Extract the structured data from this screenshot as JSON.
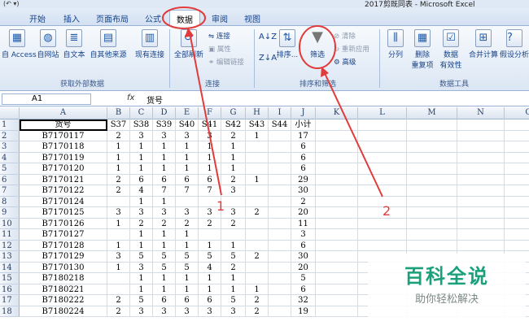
{
  "window": {
    "qat": "(↶ ▾)",
    "title": "2017剪既同表 - Microsoft Excel"
  },
  "tabs": [
    "开始",
    "插入",
    "页面布局",
    "公式",
    "数据",
    "审阅",
    "视图"
  ],
  "active_tab": "数据",
  "ribbon": {
    "get_external": {
      "from_access": "自 Access",
      "from_web": "自网站",
      "from_text": "自文本",
      "from_other": "自其他来源",
      "existing": "现有连接",
      "label": "获取外部数据"
    },
    "connections": {
      "refresh_all": "全部刷新",
      "connections": "连接",
      "properties": "属性",
      "edit_links": "编辑链接",
      "label": "连接"
    },
    "sort_filter": {
      "sort": "排序...",
      "filter": "筛选",
      "clear": "清除",
      "reapply": "重新应用",
      "advanced": "高级",
      "label": "排序和筛选"
    },
    "data_tools": {
      "text_to_cols": "分列",
      "remove_dup_1": "删除",
      "remove_dup_2": "重复项",
      "validation_1": "数据",
      "validation_2": "有效性",
      "consolidate": "合并计算",
      "whatif": "假设分析",
      "label": "数据工具"
    }
  },
  "formula_bar": {
    "name_box": "A1",
    "fx": "fx",
    "value": "货号"
  },
  "columns": [
    "A",
    "B",
    "C",
    "D",
    "E",
    "F",
    "G",
    "H",
    "I",
    "J",
    "K",
    "L",
    "M",
    "N",
    "O"
  ],
  "rows": [
    {
      "n": "1",
      "cells": [
        "货号",
        "S37",
        "S38",
        "S39",
        "S40",
        "S41",
        "S42",
        "S43",
        "S44",
        "小计"
      ]
    },
    {
      "n": "2",
      "cells": [
        "B7170117",
        "2",
        "3",
        "3",
        "3",
        "3",
        "2",
        "1",
        "",
        "17"
      ]
    },
    {
      "n": "3",
      "cells": [
        "B7170118",
        "1",
        "1",
        "1",
        "1",
        "1",
        "1",
        "",
        "",
        "6"
      ]
    },
    {
      "n": "4",
      "cells": [
        "B7170119",
        "1",
        "1",
        "1",
        "1",
        "1",
        "1",
        "",
        "",
        "6"
      ]
    },
    {
      "n": "5",
      "cells": [
        "B7170120",
        "1",
        "1",
        "1",
        "1",
        "1",
        "1",
        "",
        "",
        "6"
      ]
    },
    {
      "n": "6",
      "cells": [
        "B7170121",
        "2",
        "6",
        "6",
        "6",
        "6",
        "2",
        "1",
        "",
        "29"
      ]
    },
    {
      "n": "7",
      "cells": [
        "B7170122",
        "2",
        "4",
        "7",
        "7",
        "7",
        "3",
        "",
        "",
        "30"
      ]
    },
    {
      "n": "8",
      "cells": [
        "B7170124",
        "",
        "1",
        "1",
        "",
        "",
        "",
        "",
        "",
        "2"
      ]
    },
    {
      "n": "9",
      "cells": [
        "B7170125",
        "3",
        "3",
        "3",
        "3",
        "3",
        "3",
        "2",
        "",
        "20"
      ]
    },
    {
      "n": "10",
      "cells": [
        "B7170126",
        "1",
        "2",
        "2",
        "2",
        "2",
        "2",
        "",
        "",
        "11"
      ]
    },
    {
      "n": "11",
      "cells": [
        "B7170127",
        "",
        "1",
        "1",
        "1",
        "",
        "",
        "",
        "",
        "3"
      ]
    },
    {
      "n": "12",
      "cells": [
        "B7170128",
        "1",
        "1",
        "1",
        "1",
        "1",
        "1",
        "",
        "",
        "6"
      ]
    },
    {
      "n": "13",
      "cells": [
        "B7170129",
        "3",
        "5",
        "5",
        "5",
        "5",
        "5",
        "2",
        "",
        "30"
      ]
    },
    {
      "n": "14",
      "cells": [
        "B7170130",
        "1",
        "3",
        "5",
        "5",
        "4",
        "2",
        "",
        "",
        "20"
      ]
    },
    {
      "n": "15",
      "cells": [
        "B7180218",
        "",
        "1",
        "1",
        "1",
        "1",
        "1",
        "",
        "",
        "5"
      ]
    },
    {
      "n": "16",
      "cells": [
        "B7180221",
        "",
        "1",
        "1",
        "1",
        "1",
        "1",
        "1",
        "",
        "6"
      ]
    },
    {
      "n": "17",
      "cells": [
        "B7180222",
        "2",
        "5",
        "6",
        "6",
        "6",
        "5",
        "2",
        "",
        "32"
      ]
    },
    {
      "n": "18",
      "cells": [
        "B7180224",
        "2",
        "3",
        "3",
        "3",
        "3",
        "3",
        "2",
        "",
        "19"
      ]
    }
  ],
  "annotations": {
    "one": "1",
    "two": "2",
    "color": "#e13b3b"
  },
  "watermark": {
    "title": "百科全说",
    "subtitle": "助你轻松解决"
  }
}
